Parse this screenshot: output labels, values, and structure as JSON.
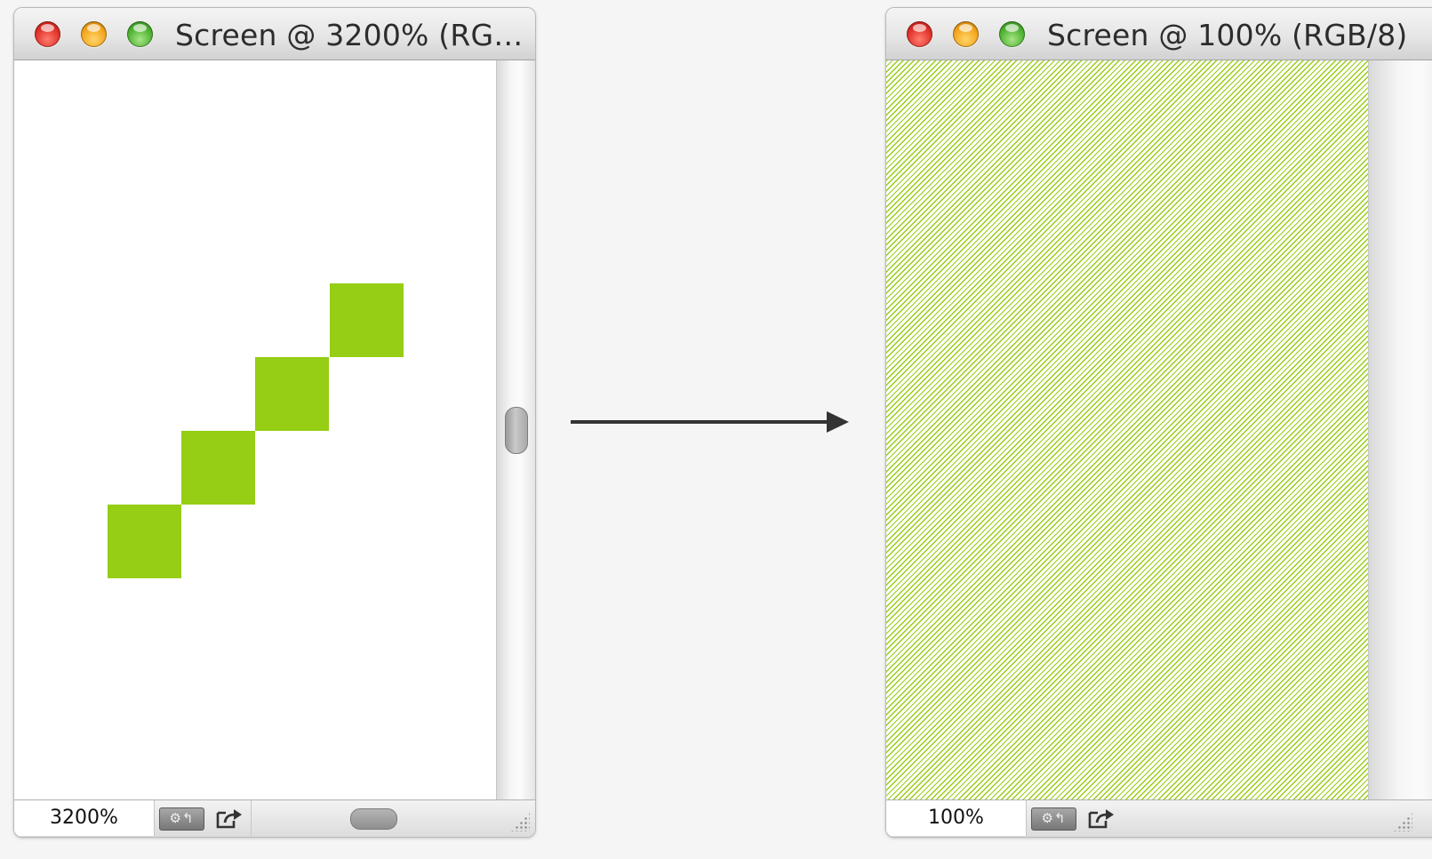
{
  "colors": {
    "pixel_green": "#95ce14",
    "close": "#e0322b",
    "minimize": "#f4a51d",
    "zoom": "#4fb232",
    "arrow": "#333333"
  },
  "left_window": {
    "title": "Screen @ 3200% (RG…",
    "zoom": "3200%",
    "icons": [
      "close-icon",
      "minimize-icon",
      "zoom-icon",
      "settings-icon",
      "export-icon",
      "resize-grip-icon"
    ]
  },
  "right_window": {
    "title": "Screen @ 100% (RGB/8)",
    "zoom": "100%",
    "icons": [
      "close-icon",
      "minimize-icon",
      "zoom-icon",
      "settings-icon",
      "export-icon",
      "resize-grip-icon"
    ]
  },
  "settings_glyph": "⚙↰",
  "connector_icon": "right-arrow-icon"
}
